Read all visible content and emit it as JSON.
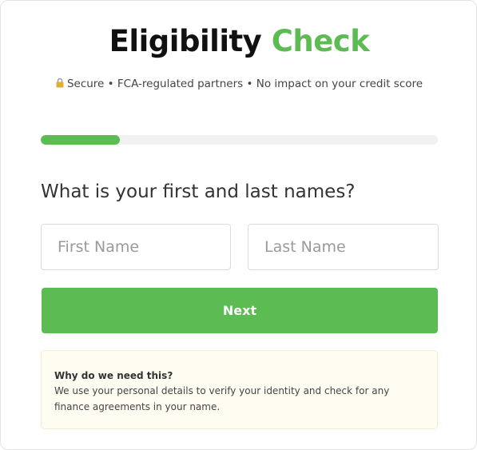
{
  "header": {
    "title_part1": "Eligibility",
    "title_part2": "Check",
    "subtitle": "Secure • FCA-regulated partners • No impact on your credit score",
    "subtitle_icon": "lock-icon"
  },
  "progress": {
    "fraction": 0.2
  },
  "form": {
    "question": "What is your first and last names?",
    "first_name_placeholder": "First Name",
    "first_name_value": "",
    "last_name_placeholder": "Last Name",
    "last_name_value": "",
    "next_label": "Next"
  },
  "info": {
    "title": "Why do we need this?",
    "text": "We use your personal details to verify your identity and check for any finance agreements in your name."
  },
  "colors": {
    "accent": "#5dbb54",
    "info_background": "#fffdf1",
    "progress_track": "#f2f2f2"
  }
}
